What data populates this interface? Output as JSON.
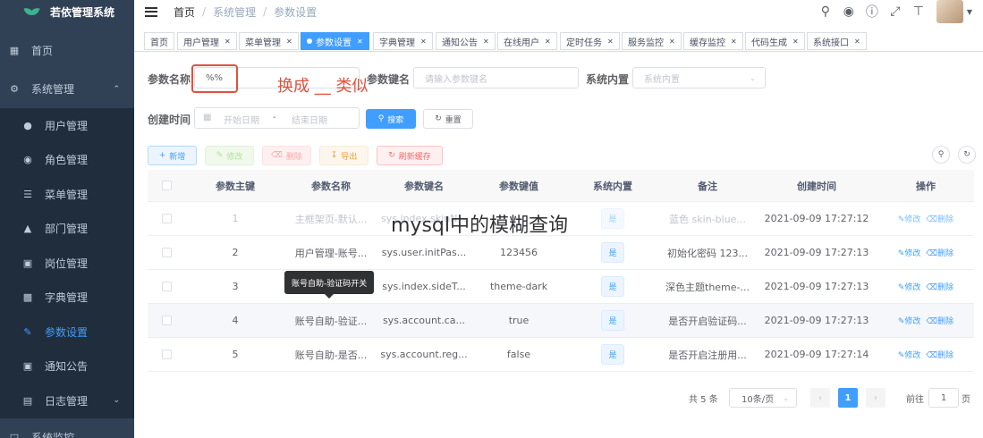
{
  "app": {
    "title": "若依管理系统"
  },
  "sidebar": {
    "items": [
      {
        "label": "首页",
        "icon": "dashboard-icon"
      },
      {
        "label": "系统管理",
        "icon": "gear-icon"
      },
      {
        "label": "用户管理",
        "icon": "user-icon"
      },
      {
        "label": "角色管理",
        "icon": "peoples-icon"
      },
      {
        "label": "菜单管理",
        "icon": "tree-table-icon"
      },
      {
        "label": "部门管理",
        "icon": "tree-icon"
      },
      {
        "label": "岗位管理",
        "icon": "post-icon"
      },
      {
        "label": "字典管理",
        "icon": "dict-icon"
      },
      {
        "label": "参数设置",
        "icon": "edit-icon"
      },
      {
        "label": "通知公告",
        "icon": "message-icon"
      },
      {
        "label": "日志管理",
        "icon": "log-icon"
      },
      {
        "label": "系统监控",
        "icon": "monitor-icon"
      }
    ]
  },
  "breadcrumb": [
    "首页",
    "系统管理",
    "参数设置"
  ],
  "tags": [
    "首页",
    "用户管理",
    "菜单管理",
    "参数设置",
    "字典管理",
    "通知公告",
    "在线用户",
    "定时任务",
    "服务监控",
    "缓存监控",
    "代码生成",
    "系统接口"
  ],
  "search": {
    "config_name_label": "参数名称",
    "config_name_value": "%%",
    "config_key_label": "参数键名",
    "config_key_placeholder": "请输入参数键名",
    "config_type_label": "系统内置",
    "config_type_placeholder": "系统内置",
    "date_label": "创建时间",
    "date_start_placeholder": "开始日期",
    "date_sep": "-",
    "date_end_placeholder": "结束日期",
    "search_button": "搜索",
    "reset_button": "重置"
  },
  "annotation": "换成 __ 类似",
  "toolbar": {
    "add": "新增",
    "edit": "修改",
    "delete": "删除",
    "export": "导出",
    "refresh_cache": "刷新缓存"
  },
  "table": {
    "headers": [
      "参数主键",
      "参数名称",
      "参数键名",
      "参数键值",
      "系统内置",
      "备注",
      "创建时间",
      "操作"
    ],
    "rows": [
      {
        "id": "1",
        "name": "主框架页-默认...",
        "key": "sys.index.skinN...",
        "value": "",
        "builtin": "是",
        "remark": "蓝色 skin-blue...",
        "created": "2021-09-09 17:27:12"
      },
      {
        "id": "2",
        "name": "用户管理-账号...",
        "key": "sys.user.initPas...",
        "value": "123456",
        "builtin": "是",
        "remark": "初始化密码 123...",
        "created": "2021-09-09 17:27:13"
      },
      {
        "id": "3",
        "name": "",
        "key": "sys.index.sideT...",
        "value": "theme-dark",
        "builtin": "是",
        "remark": "深色主题theme-...",
        "created": "2021-09-09 17:27:13"
      },
      {
        "id": "4",
        "name": "账号自助-验证...",
        "key": "sys.account.ca...",
        "value": "true",
        "builtin": "是",
        "remark": "是否开启验证码...",
        "created": "2021-09-09 17:27:13"
      },
      {
        "id": "5",
        "name": "账号自助-是否...",
        "key": "sys.account.reg...",
        "value": "false",
        "builtin": "是",
        "remark": "是否开启注册用...",
        "created": "2021-09-09 17:27:14"
      }
    ],
    "edit_label": "修改",
    "delete_label": "删除"
  },
  "tooltip": "账号自助-验证码开关",
  "overlay_caption": "mysql中的模糊查询",
  "pagination": {
    "total": "共 5 条",
    "page_size": "10条/页",
    "current_page": "1",
    "goto_label": "前往",
    "goto_value": "1",
    "page_suffix": "页"
  }
}
